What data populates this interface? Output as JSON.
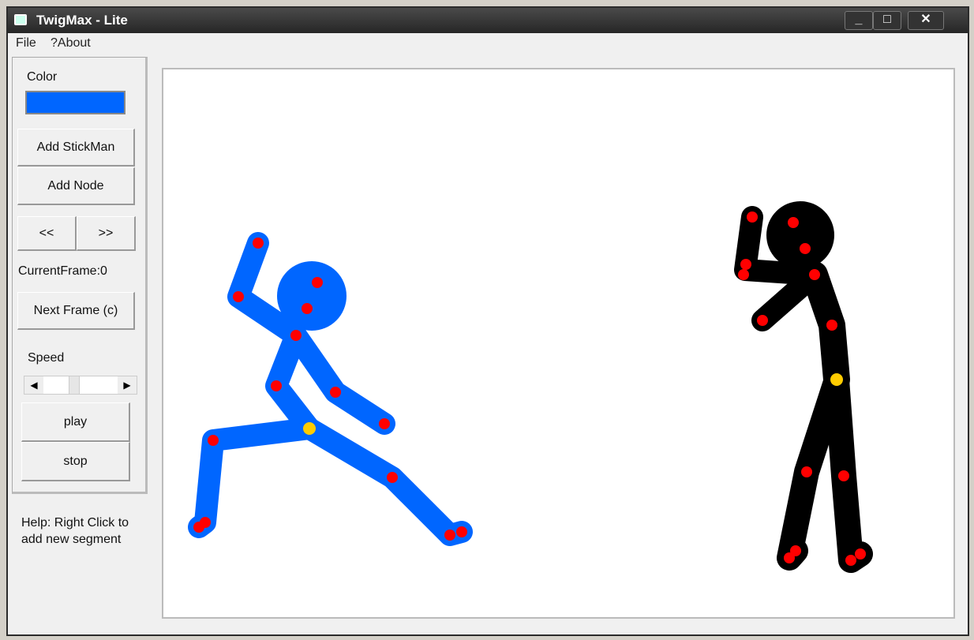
{
  "window": {
    "title": "TwigMax - Lite",
    "minimize": "_",
    "maximize": "□",
    "close": "✕"
  },
  "menu": [
    "File",
    "?About"
  ],
  "panel": {
    "color_label": "Color",
    "color_value": "#0066ff",
    "add_stickman": "Add StickMan",
    "add_node": "Add Node",
    "prev": "<<",
    "next_label": ">>",
    "current_frame": "CurrentFrame:0",
    "next_frame": "Next Frame (c)",
    "speed_label": "Speed",
    "play": "play",
    "stop": "stop"
  },
  "help": [
    "Help: Right Click to",
    "add new segment"
  ],
  "figures": [
    {
      "color": "#0066ff"
    },
    {
      "color": "#000000"
    }
  ],
  "colors": {
    "joint": "#ff0000",
    "root_joint": "#ffcc00"
  }
}
